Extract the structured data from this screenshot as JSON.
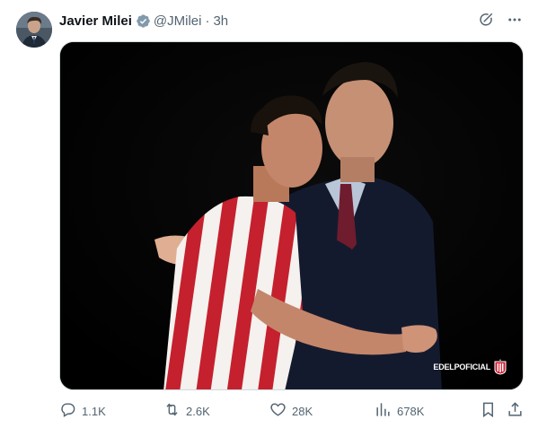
{
  "tweet": {
    "display_name": "Javier Milei",
    "handle": "@JMilei",
    "separator": "·",
    "time": "3h",
    "verified_icon": "verified-badge-icon",
    "colors": {
      "verified": "#829aab",
      "muted_text": "#536471",
      "primary_text": "#0f1419",
      "watermark_red": "#d6192c"
    }
  },
  "media": {
    "watermark_text": "EDELPOFICIAL",
    "watermark_icon": "club-crest-icon"
  },
  "actions": {
    "reply_count": "1.1K",
    "retweet_count": "2.6K",
    "like_count": "28K",
    "view_count": "678K",
    "reply_icon": "reply-icon",
    "retweet_icon": "retweet-icon",
    "like_icon": "heart-icon",
    "views_icon": "views-chart-icon",
    "bookmark_icon": "bookmark-icon",
    "share_icon": "share-icon"
  },
  "top_actions": {
    "grok_icon": "grok-icon",
    "more_icon": "more-icon"
  }
}
